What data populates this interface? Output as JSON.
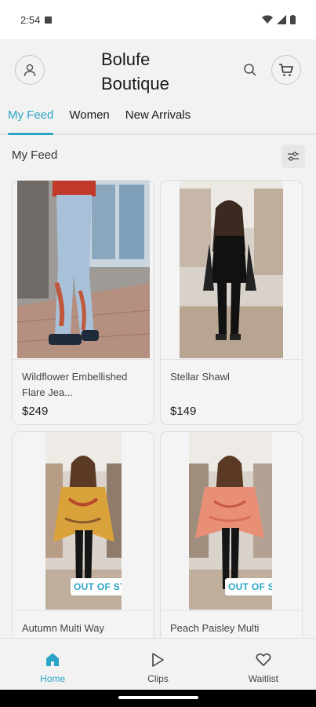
{
  "status_bar": {
    "time": "2:54"
  },
  "header": {
    "brand": "Bolufe Boutique"
  },
  "tabs": [
    {
      "label": "My Feed",
      "active": true
    },
    {
      "label": "Women",
      "active": false
    },
    {
      "label": "New Arrivals",
      "active": false
    }
  ],
  "feed": {
    "title": "My Feed"
  },
  "products": [
    {
      "name": "Wildflower Embellished Flare Jea...",
      "price": "$249",
      "badge": ""
    },
    {
      "name": "Stellar Shawl",
      "price": "$149",
      "badge": ""
    },
    {
      "name": "Autumn Multi Way",
      "price": "",
      "badge": "OUT OF STOCK"
    },
    {
      "name": "Peach Paisley Multi",
      "price": "",
      "badge": "OUT OF STOCK"
    }
  ],
  "bottom_nav": [
    {
      "label": "Home",
      "icon": "home-icon",
      "active": true
    },
    {
      "label": "Clips",
      "icon": "play-icon",
      "active": false
    },
    {
      "label": "Waitlist",
      "icon": "heart-icon",
      "active": false
    }
  ],
  "colors": {
    "accent": "#2aa5c6",
    "background": "#f2f2f2"
  }
}
